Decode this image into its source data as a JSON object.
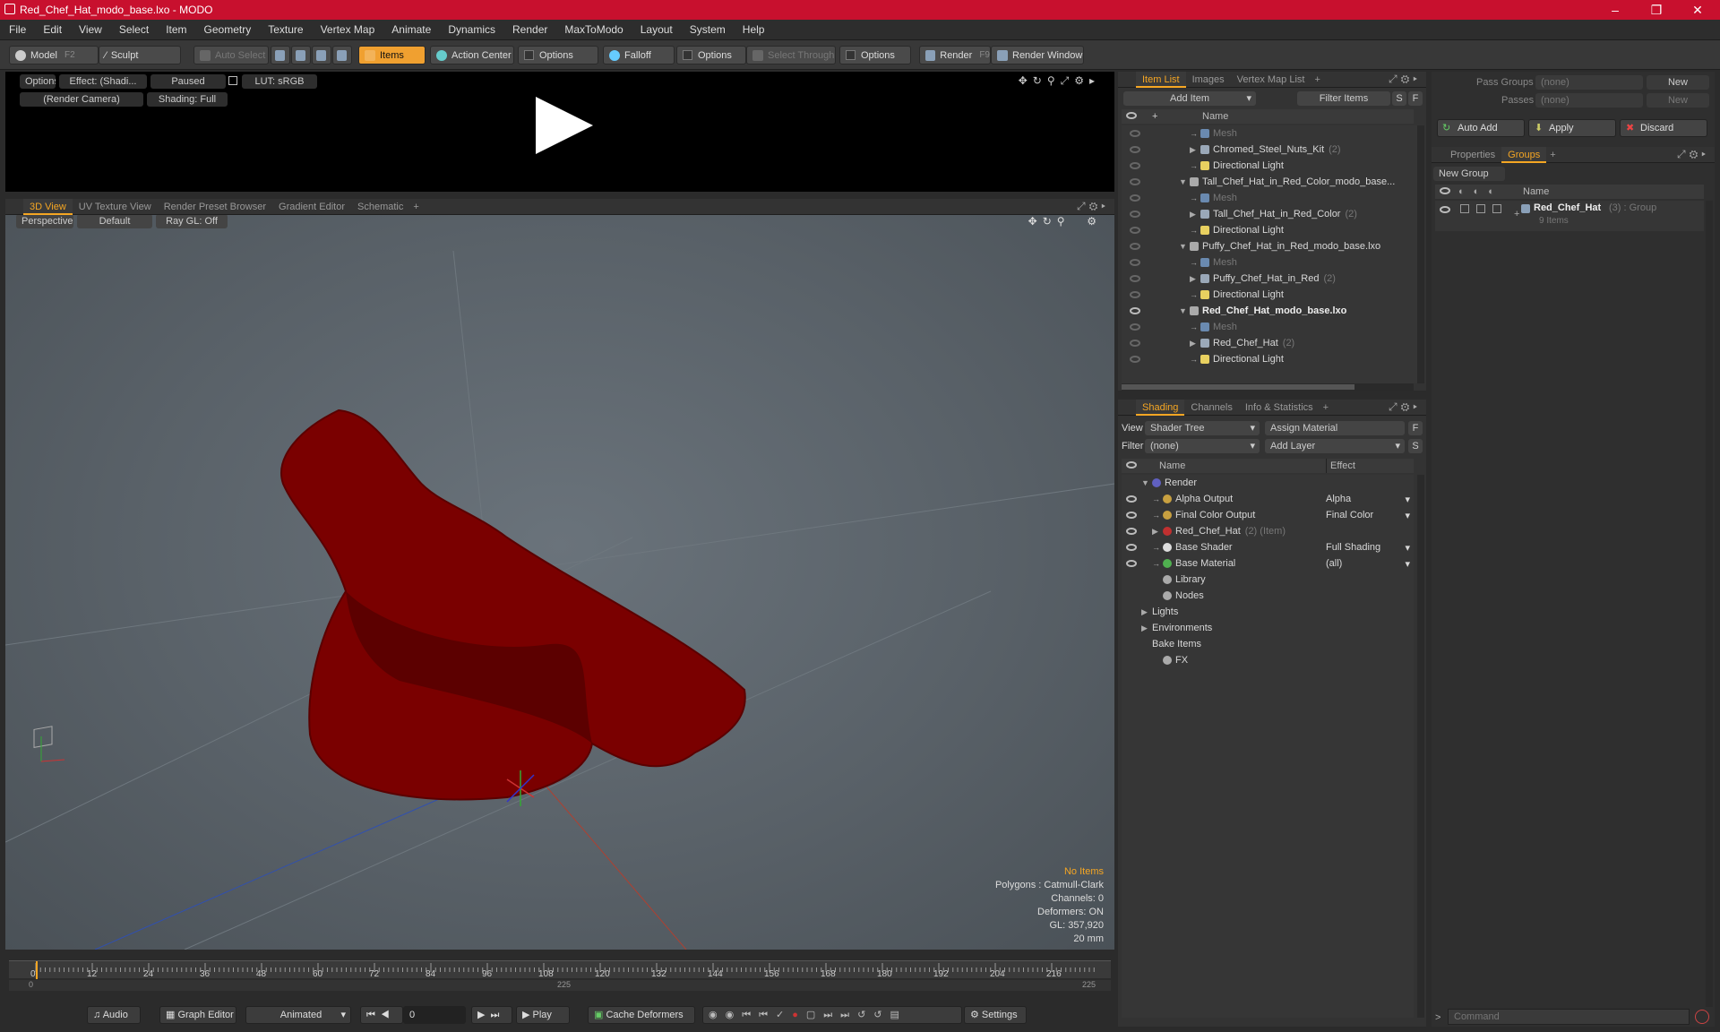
{
  "window": {
    "title": "Red_Chef_Hat_modo_base.lxo - MODO"
  },
  "menu": [
    "File",
    "Edit",
    "View",
    "Select",
    "Item",
    "Geometry",
    "Texture",
    "Vertex Map",
    "Animate",
    "Dynamics",
    "Render",
    "MaxToModo",
    "Layout",
    "System",
    "Help"
  ],
  "toolbar": {
    "model": "Model",
    "model_key": "F2",
    "sculpt": "Sculpt",
    "auto_select": "Auto Select",
    "items": "Items",
    "action_center": "Action Center",
    "options1": "Options",
    "falloff": "Falloff",
    "options2": "Options",
    "select_through": "Select Through",
    "options3": "Options",
    "render": "Render",
    "render_key": "F9",
    "render_window": "Render Window"
  },
  "render_view": {
    "options": "Options",
    "effect": "Effect: (Shadi...",
    "paused": "Paused",
    "lut": "LUT: sRGB",
    "camera": "(Render Camera)",
    "shading": "Shading: Full"
  },
  "viewport_tabs": [
    "3D View",
    "UV Texture View",
    "Render Preset Browser",
    "Gradient Editor",
    "Schematic"
  ],
  "viewport": {
    "perspective": "Perspective",
    "default": "Default",
    "raygl": "Ray GL: Off",
    "stats": [
      "No Items",
      "Polygons : Catmull-Clark",
      "Channels: 0",
      "Deformers: ON",
      "GL: 357,920",
      "20 mm"
    ],
    "accent_color": "#8b0000"
  },
  "timeline": {
    "ticks": [
      "0",
      "12",
      "24",
      "36",
      "48",
      "60",
      "72",
      "84",
      "96",
      "108",
      "120",
      "132",
      "144",
      "156",
      "168",
      "180",
      "192",
      "204",
      "216"
    ],
    "range_start": "0",
    "range_mid": "225",
    "range_end": "225"
  },
  "bottom": {
    "audio": "Audio",
    "graph_editor": "Graph Editor",
    "animated": "Animated",
    "frame": "0",
    "play": "Play",
    "cache_deformers": "Cache Deformers",
    "settings": "Settings"
  },
  "item_list": {
    "tabs": [
      "Item List",
      "Images",
      "Vertex Map List"
    ],
    "add_item": "Add Item",
    "filter_items": "Filter Items",
    "s_btn": "S",
    "f_btn": "F",
    "name_col": "Name",
    "rows": [
      {
        "name": "Mesh",
        "count": "",
        "type": "mesh",
        "sub": true
      },
      {
        "name": "Chromed_Steel_Nuts_Kit",
        "count": "(2)",
        "type": "group"
      },
      {
        "name": "Directional Light",
        "count": "",
        "type": "light"
      },
      {
        "name": "Tall_Chef_Hat_in_Red_Color_modo_base...",
        "count": "",
        "type": "scene"
      },
      {
        "name": "Mesh",
        "count": "",
        "type": "mesh",
        "sub": true
      },
      {
        "name": "Tall_Chef_Hat_in_Red_Color",
        "count": "(2)",
        "type": "group"
      },
      {
        "name": "Directional Light",
        "count": "",
        "type": "light"
      },
      {
        "name": "Puffy_Chef_Hat_in_Red_modo_base.lxo",
        "count": "",
        "type": "scene"
      },
      {
        "name": "Mesh",
        "count": "",
        "type": "mesh",
        "sub": true
      },
      {
        "name": "Puffy_Chef_Hat_in_Red",
        "count": "(2)",
        "type": "group"
      },
      {
        "name": "Directional Light",
        "count": "",
        "type": "light"
      },
      {
        "name": "Red_Chef_Hat_modo_base.lxo",
        "count": "",
        "type": "scene",
        "bold": true
      },
      {
        "name": "Mesh",
        "count": "",
        "type": "mesh",
        "sub": true
      },
      {
        "name": "Red_Chef_Hat",
        "count": "(2)",
        "type": "group"
      },
      {
        "name": "Directional Light",
        "count": "",
        "type": "light"
      }
    ]
  },
  "shading": {
    "tabs": [
      "Shading",
      "Channels",
      "Info & Statistics"
    ],
    "view_label": "View",
    "view_value": "Shader Tree",
    "assign_material": "Assign Material",
    "f_btn": "F",
    "filter_label": "Filter",
    "filter_value": "(none)",
    "add_layer": "Add Layer",
    "s_btn": "S",
    "name_col": "Name",
    "effect_col": "Effect",
    "rows": [
      {
        "name": "Render",
        "effect": "",
        "note": ""
      },
      {
        "name": "Alpha Output",
        "effect": "Alpha",
        "note": ""
      },
      {
        "name": "Final Color Output",
        "effect": "Final Color",
        "note": ""
      },
      {
        "name": "Red_Chef_Hat",
        "effect": "",
        "note": "(2) (Item)"
      },
      {
        "name": "Base Shader",
        "effect": "Full Shading",
        "note": ""
      },
      {
        "name": "Base Material",
        "effect": "(all)",
        "note": ""
      },
      {
        "name": "Library",
        "effect": "",
        "note": ""
      },
      {
        "name": "Nodes",
        "effect": "",
        "note": ""
      },
      {
        "name": "Lights",
        "effect": "",
        "note": ""
      },
      {
        "name": "Environments",
        "effect": "",
        "note": ""
      },
      {
        "name": "Bake Items",
        "effect": "",
        "note": ""
      },
      {
        "name": "FX",
        "effect": "",
        "note": ""
      }
    ]
  },
  "right_panel": {
    "pass_groups_label": "Pass Groups",
    "pass_groups_value": "(none)",
    "new1": "New",
    "passes_label": "Passes",
    "passes_value": "(none)",
    "new2": "New",
    "auto_add": "Auto Add",
    "apply": "Apply",
    "discard": "Discard",
    "tabs": [
      "Properties",
      "Groups"
    ],
    "new_group": "New Group",
    "name_col": "Name",
    "group_name": "Red_Chef_Hat",
    "group_count": "(3) : Group",
    "group_items": "9 Items",
    "command_placeholder": "Command"
  }
}
